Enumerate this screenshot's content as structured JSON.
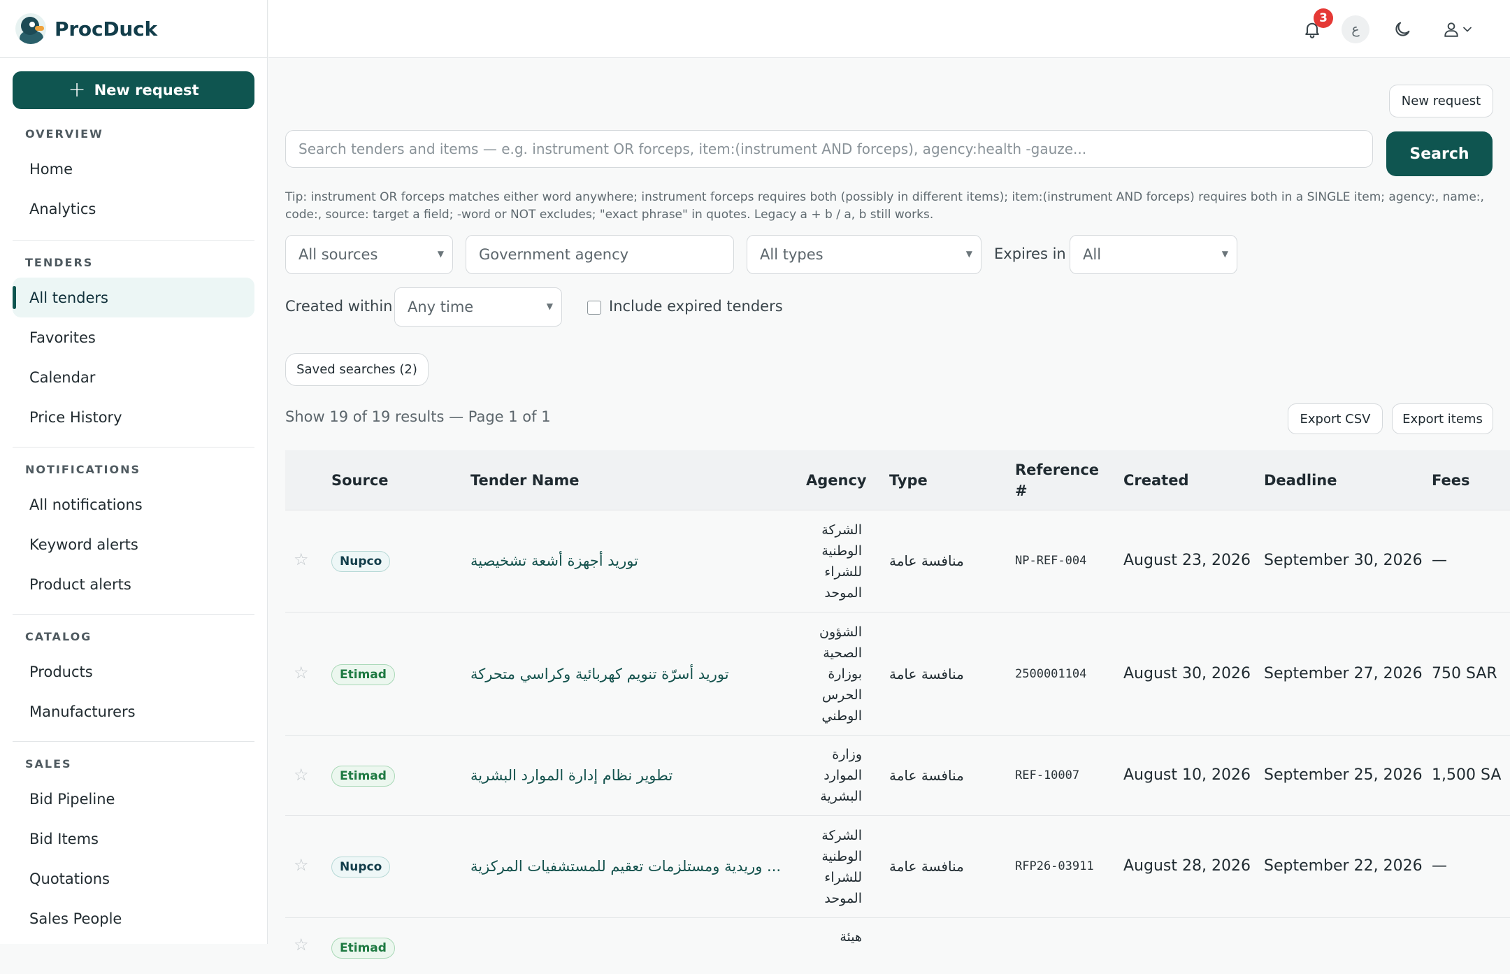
{
  "app": {
    "name": "ProcDuck"
  },
  "sidebar": {
    "new_request_label": "New request",
    "sections": [
      {
        "heading": "OVERVIEW",
        "items": [
          "Home",
          "Analytics"
        ]
      },
      {
        "heading": "TENDERS",
        "items": [
          "All tenders",
          "Favorites",
          "Calendar",
          "Price History"
        ]
      },
      {
        "heading": "NOTIFICATIONS",
        "items": [
          "All notifications",
          "Keyword alerts",
          "Product alerts"
        ]
      },
      {
        "heading": "CATALOG",
        "items": [
          "Products",
          "Manufacturers"
        ]
      },
      {
        "heading": "SALES",
        "items": [
          "Bid Pipeline",
          "Bid Items",
          "Quotations",
          "Sales People"
        ]
      }
    ],
    "active_item": "All tenders"
  },
  "topbar": {
    "notification_count": "3",
    "language_label": "ع"
  },
  "main": {
    "new_request_label": "New request",
    "search": {
      "placeholder": "Search tenders and items — e.g. instrument OR forceps, item:(instrument AND forceps), agency:health -gauze...",
      "button_label": "Search"
    },
    "tip": "Tip: instrument OR forceps matches either word anywhere; instrument forceps requires both (possibly in different items); item:(instrument AND forceps) requires both in a SINGLE item; agency:, name:, code:, source: target a field; -word or NOT excludes; \"exact phrase\" in quotes. Legacy a + b / a, b still works.",
    "filters": {
      "source": "All sources",
      "agency_placeholder": "Government agency",
      "type": "All types",
      "expires_label": "Expires in",
      "expires_value": "All",
      "created_label": "Created within",
      "created_value": "Any time",
      "include_expired_label": "Include expired tenders",
      "include_expired_checked": false
    },
    "saved_searches_label": "Saved searches (2)",
    "results_summary": "Show 19 of 19 results — Page 1 of 1",
    "export_csv_label": "Export CSV",
    "export_items_label": "Export items",
    "table": {
      "columns": [
        "Source",
        "Tender Name",
        "Agency",
        "Type",
        "Reference #",
        "Created",
        "Deadline",
        "Fees"
      ],
      "rows": [
        {
          "source": "Nupco",
          "name": "توريد أجهزة أشعة تشخيصية",
          "agency": "الشركة الوطنية للشراء الموحد",
          "type": "منافسة عامة",
          "ref": "NP-REF-004",
          "created": "August 23, 2026",
          "deadline": "September 30, 2026",
          "fees": "—"
        },
        {
          "source": "Etimad",
          "name": "توريد أسرّة تنويم كهربائية وكراسي متحركة",
          "agency": "الشؤون الصحية بوزارة الحرس الوطني",
          "type": "منافسة عامة",
          "ref": "2500001104",
          "created": "August 30, 2026",
          "deadline": "September 27, 2026",
          "fees": "750 SAR"
        },
        {
          "source": "Etimad",
          "name": "تطوير نظام إدارة الموارد البشرية",
          "agency": "وزارة الموارد البشرية",
          "type": "منافسة عامة",
          "ref": "REF-10007",
          "created": "August 10, 2026",
          "deadline": "September 25, 2026",
          "fees": "1,500 SA"
        },
        {
          "source": "Nupco",
          "name": "... وريدية ومستلزمات تعقيم للمستشفيات المركزية",
          "agency": "الشركة الوطنية للشراء الموحد",
          "type": "منافسة عامة",
          "ref": "RFP26-03911",
          "created": "August 28, 2026",
          "deadline": "September 22, 2026",
          "fees": "—"
        },
        {
          "source": "Etimad",
          "name": "",
          "agency": "هيئة",
          "type": "",
          "ref": "",
          "created": "",
          "deadline": "",
          "fees": ""
        }
      ]
    }
  }
}
